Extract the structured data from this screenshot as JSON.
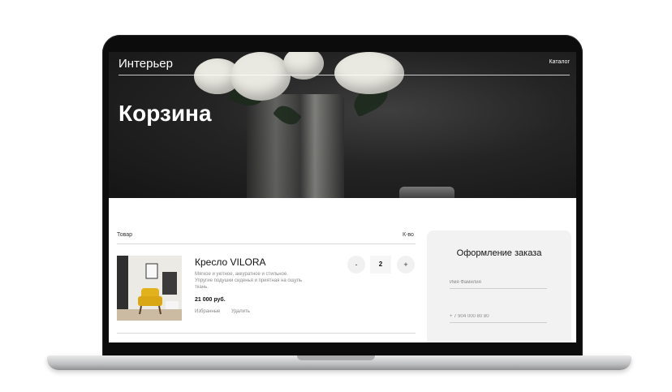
{
  "header": {
    "brand": "Интерьер",
    "nav_catalog": "Каталог"
  },
  "hero": {
    "title": "Корзина"
  },
  "cart": {
    "col_product": "Товар",
    "col_qty": "К-во",
    "items": [
      {
        "name": "Кресло VILORA",
        "description": "Мягкое и уютное, аккуратное и стильное. Упругие подушки сиденья и приятная на ощупь ткань.",
        "price": "21 000 руб.",
        "favorite_label": "Избранные",
        "remove_label": "Удалить",
        "qty_minus": "-",
        "qty_value": "2",
        "qty_plus": "+"
      }
    ]
  },
  "order": {
    "title": "Оформление заказа",
    "name_placeholder": "Имя Фамилия",
    "phone_placeholder": "+ 7 904 000 80 80"
  },
  "colors": {
    "laptop_bezel": "#0c0c0d",
    "hero_dark": "#242424",
    "panel_bg": "#f2f2f2",
    "accent_chair": "#e2b21c"
  }
}
